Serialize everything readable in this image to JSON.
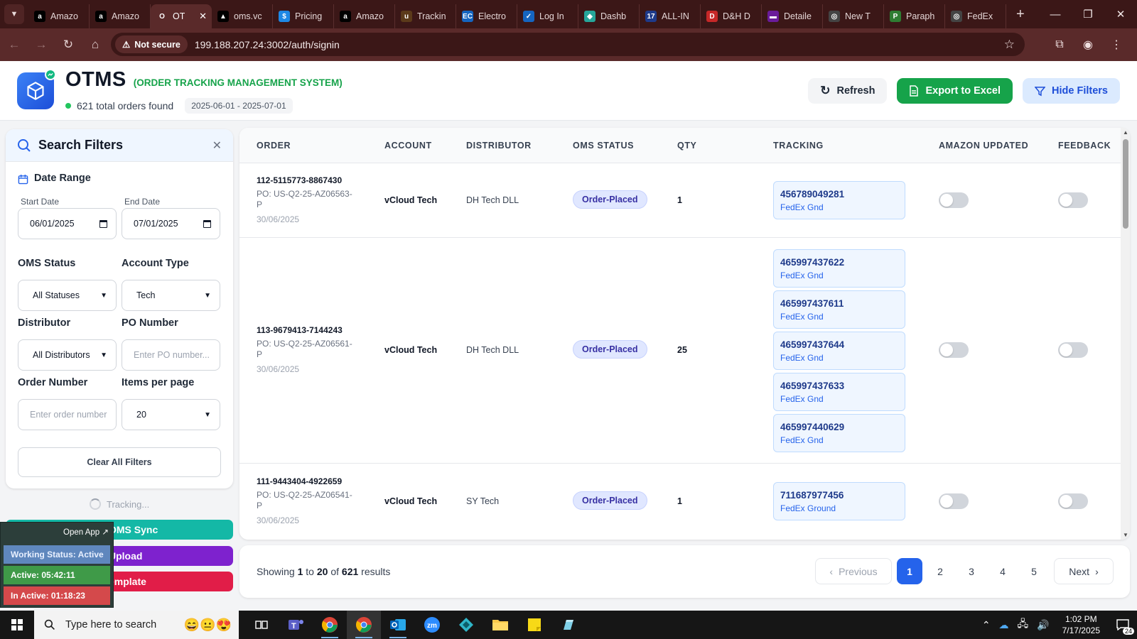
{
  "browser": {
    "tabs": [
      {
        "title": "Amazo",
        "fav": "a",
        "color": "#000000"
      },
      {
        "title": "Amazo",
        "fav": "a",
        "color": "#000000"
      },
      {
        "title": "OT",
        "fav": "O",
        "color": "#5a2a2a",
        "active": true
      },
      {
        "title": "oms.vc",
        "fav": "▲",
        "color": "#000000"
      },
      {
        "title": "Pricing",
        "fav": "$",
        "color": "#1e88e5"
      },
      {
        "title": "Amazo",
        "fav": "a",
        "color": "#000000"
      },
      {
        "title": "Trackin",
        "fav": "u",
        "color": "#5b3a1a"
      },
      {
        "title": "Electro",
        "fav": "EC",
        "color": "#1565c0"
      },
      {
        "title": "Log In",
        "fav": "✓",
        "color": "#1565c0"
      },
      {
        "title": "Dashb",
        "fav": "◆",
        "color": "#26a69a"
      },
      {
        "title": "ALL-IN",
        "fav": "17",
        "color": "#1e3a8a"
      },
      {
        "title": "D&H D",
        "fav": "D",
        "color": "#c62828"
      },
      {
        "title": "Detaile",
        "fav": "▬",
        "color": "#6a1b9a"
      },
      {
        "title": "New T",
        "fav": "◎",
        "color": "#444444"
      },
      {
        "title": "Paraph",
        "fav": "P",
        "color": "#2e7d32"
      },
      {
        "title": "FedEx",
        "fav": "◎",
        "color": "#444444"
      }
    ],
    "not_secure": "Not secure",
    "url": "199.188.207.24:3002/auth/signin"
  },
  "header": {
    "title": "OTMS",
    "subtitle": "(ORDER TRACKING MANAGEMENT SYSTEM)",
    "orders_found": "621 total orders found",
    "date_chip": "2025-06-01 - 2025-07-01",
    "refresh_label": "Refresh",
    "export_label": "Export to Excel",
    "hide_filters_label": "Hide Filters"
  },
  "filters": {
    "title": "Search Filters",
    "date_range_label": "Date Range",
    "start_date_label": "Start Date",
    "start_date_value": "06/01/2025",
    "end_date_label": "End Date",
    "end_date_value": "07/01/2025",
    "oms_status_label": "OMS Status",
    "oms_status_value": "All Statuses",
    "account_type_label": "Account Type",
    "account_type_value": "Tech",
    "distributor_label": "Distributor",
    "distributor_value": "All Distributors",
    "po_number_label": "PO Number",
    "po_number_placeholder": "Enter PO number...",
    "order_number_label": "Order Number",
    "order_number_placeholder": "Enter order number",
    "items_per_page_label": "Items per page",
    "items_per_page_value": "20",
    "clear_label": "Clear All Filters"
  },
  "side": {
    "tracking_label": "Tracking...",
    "sync_label": "OMS Sync",
    "upload_label": "Upload",
    "template_label": "emplate"
  },
  "overlay": {
    "open_app": "Open App ↗",
    "status": "Working Status: Active",
    "active": "Active: 05:42:11",
    "inactive": "In Active: 01:18:23"
  },
  "table": {
    "headers": [
      "ORDER",
      "ACCOUNT",
      "DISTRIBUTOR",
      "OMS STATUS",
      "QTY",
      "TRACKING",
      "AMAZON UPDATED",
      "FEEDBACK"
    ],
    "rows": [
      {
        "order": "112-5115773-8867430",
        "po": "PO: US-Q2-25-AZ06563-P",
        "date": "30/06/2025",
        "account": "vCloud Tech",
        "distributor": "DH Tech DLL",
        "status": "Order-Placed",
        "qty": "1",
        "tracking": [
          {
            "number": "456789049281",
            "carrier": "FedEx Gnd"
          }
        ],
        "amazon_updated": false,
        "feedback": false
      },
      {
        "order": "113-9679413-7144243",
        "po": "PO: US-Q2-25-AZ06561-P",
        "date": "30/06/2025",
        "account": "vCloud Tech",
        "distributor": "DH Tech DLL",
        "status": "Order-Placed",
        "qty": "25",
        "tracking": [
          {
            "number": "465997437622",
            "carrier": "FedEx Gnd"
          },
          {
            "number": "465997437611",
            "carrier": "FedEx Gnd"
          },
          {
            "number": "465997437644",
            "carrier": "FedEx Gnd"
          },
          {
            "number": "465997437633",
            "carrier": "FedEx Gnd"
          },
          {
            "number": "465997440629",
            "carrier": "FedEx Gnd"
          }
        ],
        "amazon_updated": false,
        "feedback": false
      },
      {
        "order": "111-9443404-4922659",
        "po": "PO: US-Q2-25-AZ06541-P",
        "date": "30/06/2025",
        "account": "vCloud Tech",
        "distributor": "SY Tech",
        "status": "Order-Placed",
        "qty": "1",
        "tracking": [
          {
            "number": "711687977456",
            "carrier": "FedEx Ground"
          }
        ],
        "amazon_updated": false,
        "feedback": false
      }
    ]
  },
  "pagination": {
    "showing_prefix": "Showing",
    "from": "1",
    "to_word": "to",
    "to": "20",
    "of_word": "of",
    "total": "621",
    "results_word": "results",
    "previous_label": "Previous",
    "pages": [
      "1",
      "2",
      "3",
      "4",
      "5"
    ],
    "current_page": "1",
    "next_label": "Next"
  },
  "taskbar": {
    "search_placeholder": "Type here to search",
    "time": "1:02 PM",
    "date": "7/17/2025",
    "notification_count": "24"
  }
}
